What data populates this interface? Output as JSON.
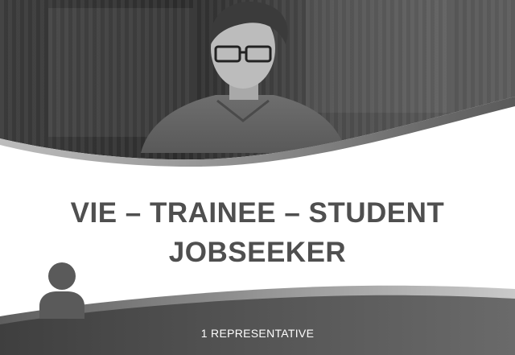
{
  "hero": {
    "image": "man-with-glasses-photo"
  },
  "title": {
    "line1": "VIE – TRAINEE – STUDENT",
    "line2": "JOBSEEKER"
  },
  "footer": {
    "icon": "person-icon",
    "representatives_label": "1 REPRESENTATIVE"
  },
  "colors": {
    "title_text": "#4f4f4f",
    "band_dark": "#3f3f3f",
    "band_light": "#6a6a6a"
  }
}
